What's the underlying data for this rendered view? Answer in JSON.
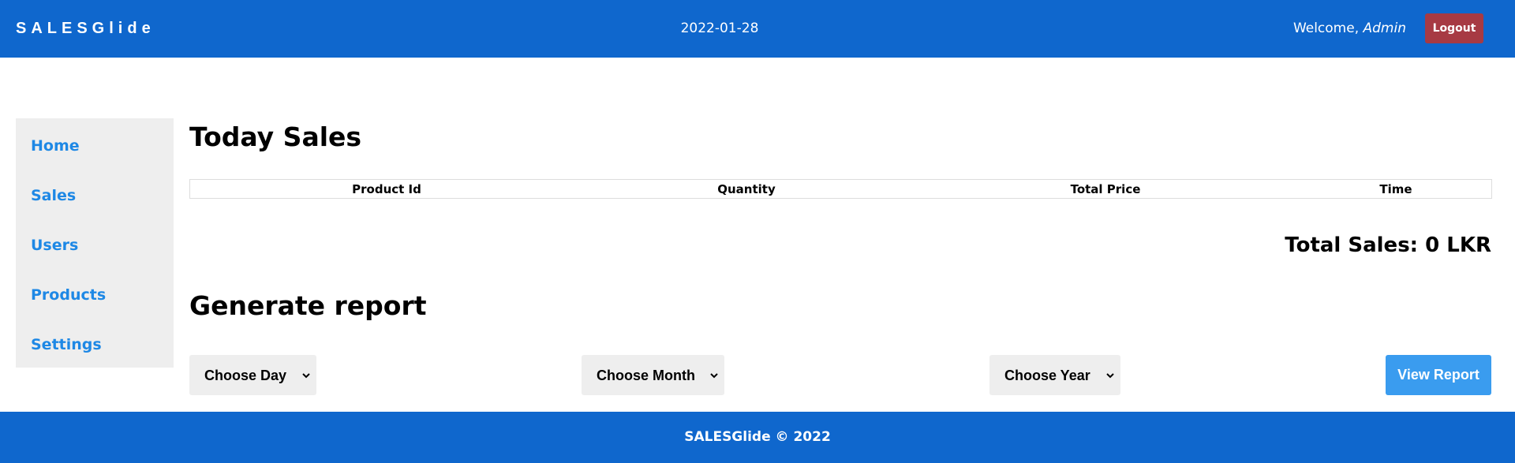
{
  "header": {
    "brand": "SALESGlide",
    "date": "2022-01-28",
    "welcome_prefix": "Welcome, ",
    "user_name": "Admin",
    "logout_label": "Logout"
  },
  "sidebar": {
    "items": [
      {
        "label": "Home"
      },
      {
        "label": "Sales"
      },
      {
        "label": "Users"
      },
      {
        "label": "Products"
      },
      {
        "label": "Settings"
      }
    ]
  },
  "today_sales": {
    "title": "Today Sales",
    "columns": [
      "Product Id",
      "Quantity",
      "Total Price",
      "Time"
    ],
    "rows": [],
    "total_label": "Total Sales: 0 LKR"
  },
  "report": {
    "title": "Generate report",
    "day_select": "Choose Day",
    "month_select": "Choose Month",
    "year_select": "Choose Year",
    "view_button": "View Report"
  },
  "footer": {
    "text": "SALESGlide © 2022"
  },
  "colors": {
    "header_bg": "#0f67cd",
    "logout_bg": "#a73a43",
    "link": "#1e88e5",
    "button_bg": "#3a9cef",
    "panel_bg": "#eeeeee"
  }
}
